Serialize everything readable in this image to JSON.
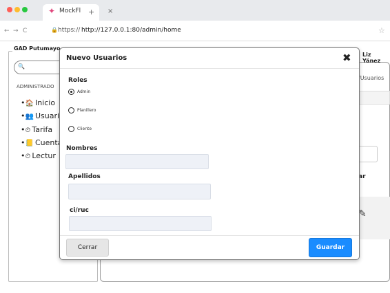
{
  "browser": {
    "tab_title": "MockFl",
    "new_tab_glyph": "+",
    "tab_close_glyph": "×",
    "url_scheme": "https://",
    "url": "http://127.0.0.1:80/admin/home",
    "colors": {
      "red": "#ff5f57",
      "yellow": "#febc2e",
      "green": "#28c840"
    }
  },
  "page": {
    "brand": "GAD Putumayo",
    "user_name": "Liz Yánez",
    "breadcrumb": "/Usuarios",
    "search_placeholder": "",
    "sidebar": {
      "section_label": "ADMINISTRADO",
      "items": [
        {
          "label": "Inicio",
          "icon": "home-icon",
          "glyph": "🏠"
        },
        {
          "label": "Usuari",
          "icon": "users-icon",
          "glyph": "👥"
        },
        {
          "label": "Tarifa",
          "icon": "tachometer-icon",
          "glyph": "⏲"
        },
        {
          "label": "Cuenta",
          "icon": "book-icon",
          "glyph": "📒"
        },
        {
          "label": "Lectur",
          "icon": "tachometer-icon",
          "glyph": "⏲"
        }
      ]
    },
    "background_text": {
      "partial_heading": "ar"
    }
  },
  "modal": {
    "title": "Nuevo Usuarios",
    "close_glyph": "✖",
    "roles_label": "Roles",
    "roles": [
      {
        "label": "Admin",
        "checked": true
      },
      {
        "label": "Planillero",
        "checked": false
      },
      {
        "label": "Cliente",
        "checked": false
      }
    ],
    "fields": [
      {
        "label": "Nombres",
        "value": ""
      },
      {
        "label": "Apellidos",
        "value": ""
      },
      {
        "label": "ci/ruc",
        "value": ""
      }
    ],
    "cancel_label": "Cerrar",
    "save_label": "Guardar",
    "accent_color": "#1a8cff"
  }
}
